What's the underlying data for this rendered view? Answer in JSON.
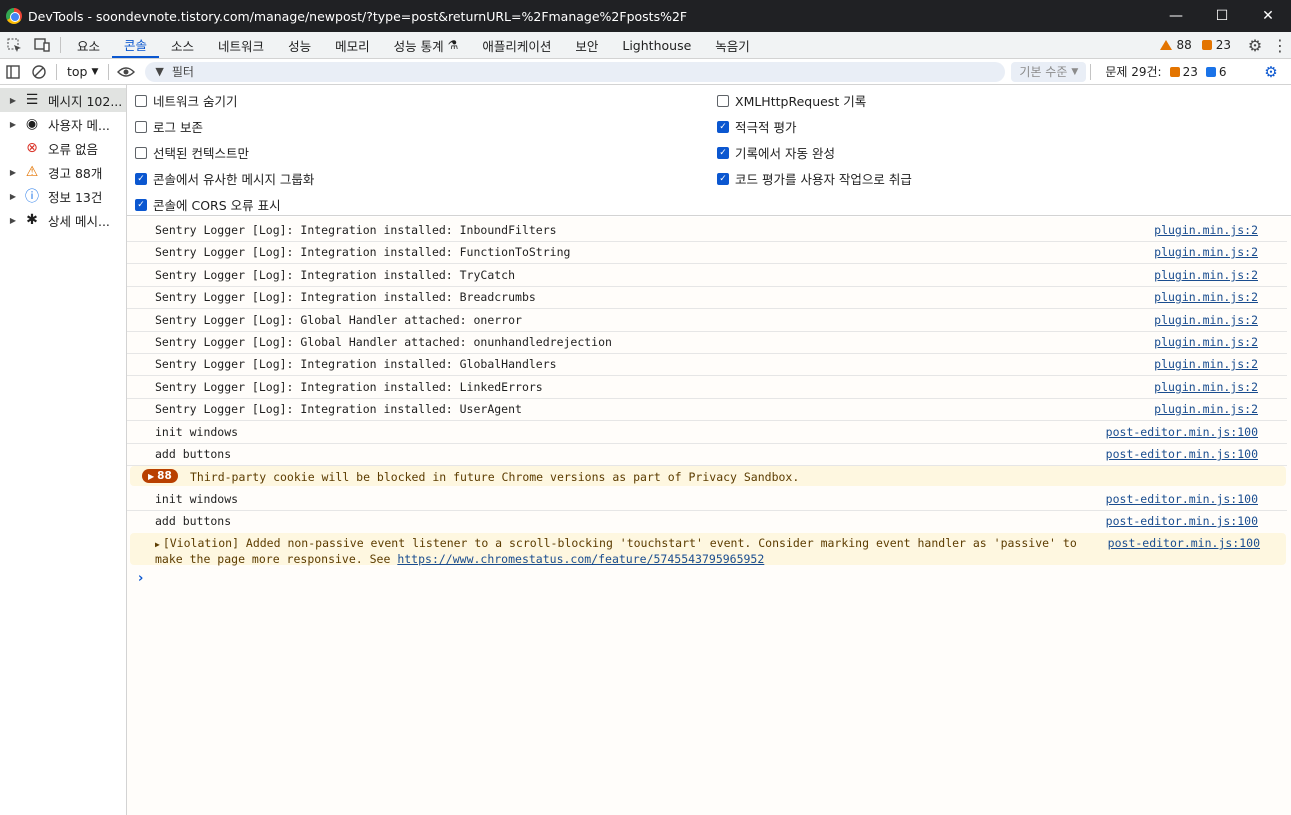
{
  "window": {
    "title": "DevTools - soondevnote.tistory.com/manage/newpost/?type=post&returnURL=%2Fmanage%2Fposts%2F",
    "minimize": "—",
    "maximize": "☐",
    "close": "✕"
  },
  "tabs": [
    "요소",
    "콘솔",
    "소스",
    "네트워크",
    "성능",
    "메모리",
    "성능 통계",
    "애플리케이션",
    "보안",
    "Lighthouse",
    "녹음기"
  ],
  "tab_extra_icon": "⚗",
  "header_counts": {
    "warnings": "88",
    "errors": "23"
  },
  "toolbar": {
    "context": "top",
    "filter_placeholder": "필터",
    "levels": "기본 수준",
    "issues_label": "문제 29건:",
    "issues_errors": "23",
    "issues_info": "6"
  },
  "sidebar": [
    {
      "label": "메시지 102...",
      "icon": "list-icon",
      "glyph": "☰",
      "arrow": "▶"
    },
    {
      "label": "사용자 메...",
      "icon": "user-icon",
      "glyph": "◉",
      "arrow": "▶"
    },
    {
      "label": "오류 없음",
      "icon": "error-icon",
      "glyph": "⊗",
      "arrow": ""
    },
    {
      "label": "경고 88개",
      "icon": "warning-icon",
      "glyph": "⚠",
      "arrow": "▶"
    },
    {
      "label": "정보 13건",
      "icon": "info-icon",
      "glyph": "ⓘ",
      "arrow": "▶"
    },
    {
      "label": "상세 메시...",
      "icon": "bug-icon",
      "glyph": "✱",
      "arrow": "▶"
    }
  ],
  "settings": {
    "left": [
      {
        "label": "네트워크 숨기기",
        "checked": false
      },
      {
        "label": "로그 보존",
        "checked": false
      },
      {
        "label": "선택된 컨텍스트만",
        "checked": false
      },
      {
        "label": "콘솔에서 유사한 메시지 그룹화",
        "checked": true
      },
      {
        "label": "콘솔에 CORS 오류 표시",
        "checked": true
      }
    ],
    "right": [
      {
        "label": "XMLHttpRequest 기록",
        "checked": false
      },
      {
        "label": "적극적 평가",
        "checked": true
      },
      {
        "label": "기록에서 자동 완성",
        "checked": true
      },
      {
        "label": "코드 평가를 사용자 작업으로 취급",
        "checked": true
      }
    ]
  },
  "messages": [
    {
      "text": "Sentry Logger [Log]: Integration installed: InboundFilters",
      "source": "plugin.min.js:2"
    },
    {
      "text": "Sentry Logger [Log]: Integration installed: FunctionToString",
      "source": "plugin.min.js:2"
    },
    {
      "text": "Sentry Logger [Log]: Integration installed: TryCatch",
      "source": "plugin.min.js:2"
    },
    {
      "text": "Sentry Logger [Log]: Integration installed: Breadcrumbs",
      "source": "plugin.min.js:2"
    },
    {
      "text": "Sentry Logger [Log]: Global Handler attached: onerror",
      "source": "plugin.min.js:2"
    },
    {
      "text": "Sentry Logger [Log]: Global Handler attached: onunhandledrejection",
      "source": "plugin.min.js:2"
    },
    {
      "text": "Sentry Logger [Log]: Integration installed: GlobalHandlers",
      "source": "plugin.min.js:2"
    },
    {
      "text": "Sentry Logger [Log]: Integration installed: LinkedErrors",
      "source": "plugin.min.js:2"
    },
    {
      "text": "Sentry Logger [Log]: Integration installed: UserAgent",
      "source": "plugin.min.js:2"
    },
    {
      "text": "init windows",
      "source": "post-editor.min.js:100"
    },
    {
      "text": "add buttons",
      "source": "post-editor.min.js:100"
    }
  ],
  "warning_group": {
    "count": "88",
    "text": "Third-party cookie will be blocked in future Chrome versions as part of Privacy Sandbox."
  },
  "messages2": [
    {
      "text": "init windows",
      "source": "post-editor.min.js:100"
    },
    {
      "text": "add buttons",
      "source": "post-editor.min.js:100"
    }
  ],
  "violation": {
    "text": "[Violation] Added non-passive event listener to a scroll-blocking 'touchstart' event. Consider marking event handler as 'passive' to make the page more responsive. See ",
    "link": "https://www.chromestatus.com/feature/5745543795965952",
    "source": "post-editor.min.js:100"
  },
  "prompt": "›"
}
